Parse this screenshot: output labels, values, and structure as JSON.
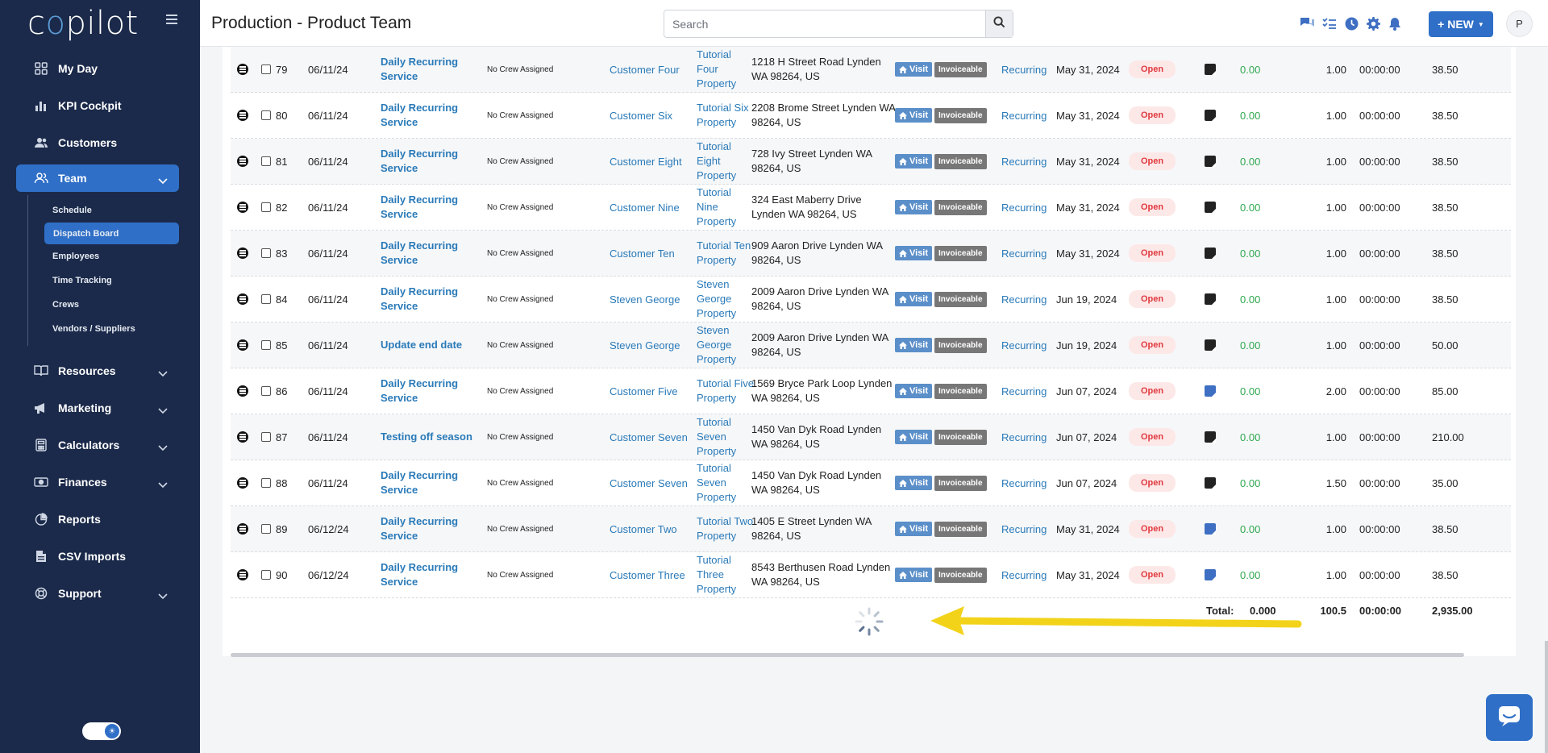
{
  "brand": {
    "logo": "copilot",
    "accent": "#2f6fc7",
    "sidebar_bg": "#1b2a4a"
  },
  "header": {
    "title": "Production - Product Team",
    "search_placeholder": "Search",
    "new_label": "+ NEW",
    "avatar_initial": "P",
    "icons": [
      "chat-icon",
      "checklist-icon",
      "clock-icon",
      "gear-icon",
      "bell-icon"
    ]
  },
  "sidebar": {
    "items": [
      {
        "label": "My Day",
        "icon": "grid-icon"
      },
      {
        "label": "KPI Cockpit",
        "icon": "bar-chart-icon"
      },
      {
        "label": "Customers",
        "icon": "users-icon"
      },
      {
        "label": "Team",
        "icon": "team-icon"
      },
      {
        "label": "Resources",
        "icon": "book-icon"
      },
      {
        "label": "Marketing",
        "icon": "megaphone-icon"
      },
      {
        "label": "Calculators",
        "icon": "calculator-icon"
      },
      {
        "label": "Finances",
        "icon": "money-icon"
      },
      {
        "label": "Reports",
        "icon": "pie-chart-icon"
      },
      {
        "label": "CSV Imports",
        "icon": "file-icon"
      },
      {
        "label": "Support",
        "icon": "lifebuoy-icon"
      }
    ],
    "team_sub": [
      "Schedule",
      "Dispatch Board",
      "Employees",
      "Time Tracking",
      "Crews",
      "Vendors / Suppliers"
    ]
  },
  "table": {
    "badge_visit": "Visit",
    "badge_invoiceable": "Invoiceable",
    "rows": [
      {
        "num": "79",
        "date": "06/11/24",
        "title": "Daily Recurring Service",
        "crew": "No Crew Assigned",
        "customer": "Customer Four",
        "property": "Tutorial Four Property",
        "address": "1218 H Street Road Lynden WA 98264, US",
        "type": "Recurring",
        "end": "May 31, 2024",
        "status": "Open",
        "note": "dark",
        "amount": "0.00",
        "qty": "1.00",
        "time": "00:00:00",
        "price": "38.50"
      },
      {
        "num": "80",
        "date": "06/11/24",
        "title": "Daily Recurring Service",
        "crew": "No Crew Assigned",
        "customer": "Customer Six",
        "property": "Tutorial Six Property",
        "address": "2208 Brome Street Lynden WA 98264, US",
        "type": "Recurring",
        "end": "May 31, 2024",
        "status": "Open",
        "note": "dark",
        "amount": "0.00",
        "qty": "1.00",
        "time": "00:00:00",
        "price": "38.50"
      },
      {
        "num": "81",
        "date": "06/11/24",
        "title": "Daily Recurring Service",
        "crew": "No Crew Assigned",
        "customer": "Customer Eight",
        "property": "Tutorial Eight Property",
        "address": "728 Ivy Street Lynden WA 98264, US",
        "type": "Recurring",
        "end": "May 31, 2024",
        "status": "Open",
        "note": "dark",
        "amount": "0.00",
        "qty": "1.00",
        "time": "00:00:00",
        "price": "38.50"
      },
      {
        "num": "82",
        "date": "06/11/24",
        "title": "Daily Recurring Service",
        "crew": "No Crew Assigned",
        "customer": "Customer Nine",
        "property": "Tutorial Nine Property",
        "address": "324 East Maberry Drive Lynden WA 98264, US",
        "type": "Recurring",
        "end": "May 31, 2024",
        "status": "Open",
        "note": "dark",
        "amount": "0.00",
        "qty": "1.00",
        "time": "00:00:00",
        "price": "38.50"
      },
      {
        "num": "83",
        "date": "06/11/24",
        "title": "Daily Recurring Service",
        "crew": "No Crew Assigned",
        "customer": "Customer Ten",
        "property": "Tutorial Ten Property",
        "address": "909 Aaron Drive Lynden WA 98264, US",
        "type": "Recurring",
        "end": "May 31, 2024",
        "status": "Open",
        "note": "dark",
        "amount": "0.00",
        "qty": "1.00",
        "time": "00:00:00",
        "price": "38.50"
      },
      {
        "num": "84",
        "date": "06/11/24",
        "title": "Daily Recurring Service",
        "crew": "No Crew Assigned",
        "customer": "Steven George",
        "property": "Steven George Property",
        "address": "2009 Aaron Drive Lynden WA 98264, US",
        "type": "Recurring",
        "end": "Jun 19, 2024",
        "status": "Open",
        "note": "dark",
        "amount": "0.00",
        "qty": "1.00",
        "time": "00:00:00",
        "price": "38.50"
      },
      {
        "num": "85",
        "date": "06/11/24",
        "title": "Update end date",
        "crew": "No Crew Assigned",
        "customer": "Steven George",
        "property": "Steven George Property",
        "address": "2009 Aaron Drive Lynden WA 98264, US",
        "type": "Recurring",
        "end": "Jun 19, 2024",
        "status": "Open",
        "note": "dark",
        "amount": "0.00",
        "qty": "1.00",
        "time": "00:00:00",
        "price": "50.00"
      },
      {
        "num": "86",
        "date": "06/11/24",
        "title": "Daily Recurring Service",
        "crew": "No Crew Assigned",
        "customer": "Customer Five",
        "property": "Tutorial Five Property",
        "address": "1569 Bryce Park Loop Lynden WA 98264, US",
        "type": "Recurring",
        "end": "Jun 07, 2024",
        "status": "Open",
        "note": "blue",
        "amount": "0.00",
        "qty": "2.00",
        "time": "00:00:00",
        "price": "85.00"
      },
      {
        "num": "87",
        "date": "06/11/24",
        "title": "Testing off season",
        "crew": "No Crew Assigned",
        "customer": "Customer Seven",
        "property": "Tutorial Seven Property",
        "address": "1450 Van Dyk Road Lynden WA 98264, US",
        "type": "Recurring",
        "end": "Jun 07, 2024",
        "status": "Open",
        "note": "dark",
        "amount": "0.00",
        "qty": "1.00",
        "time": "00:00:00",
        "price": "210.00"
      },
      {
        "num": "88",
        "date": "06/11/24",
        "title": "Daily Recurring Service",
        "crew": "No Crew Assigned",
        "customer": "Customer Seven",
        "property": "Tutorial Seven Property",
        "address": "1450 Van Dyk Road Lynden WA 98264, US",
        "type": "Recurring",
        "end": "Jun 07, 2024",
        "status": "Open",
        "note": "dark",
        "amount": "0.00",
        "qty": "1.50",
        "time": "00:00:00",
        "price": "35.00"
      },
      {
        "num": "89",
        "date": "06/12/24",
        "title": "Daily Recurring Service",
        "crew": "No Crew Assigned",
        "customer": "Customer Two",
        "property": "Tutorial Two Property",
        "address": "1405 E Street Lynden WA 98264, US",
        "type": "Recurring",
        "end": "May 31, 2024",
        "status": "Open",
        "note": "blue",
        "amount": "0.00",
        "qty": "1.00",
        "time": "00:00:00",
        "price": "38.50"
      },
      {
        "num": "90",
        "date": "06/12/24",
        "title": "Daily Recurring Service",
        "crew": "No Crew Assigned",
        "customer": "Customer Three",
        "property": "Tutorial Three Property",
        "address": "8543 Berthusen Road Lynden WA 98264, US",
        "type": "Recurring",
        "end": "May 31, 2024",
        "status": "Open",
        "note": "blue",
        "amount": "0.00",
        "qty": "1.00",
        "time": "00:00:00",
        "price": "38.50"
      }
    ],
    "totals": {
      "label": "Total:",
      "amount": "0.000",
      "qty": "100.5",
      "time": "00:00:00",
      "price": "2,935.00"
    }
  },
  "status_colors": {
    "open_bg": "#fde8e8",
    "open_text": "#e0393e",
    "amount": "#2fa84f"
  }
}
